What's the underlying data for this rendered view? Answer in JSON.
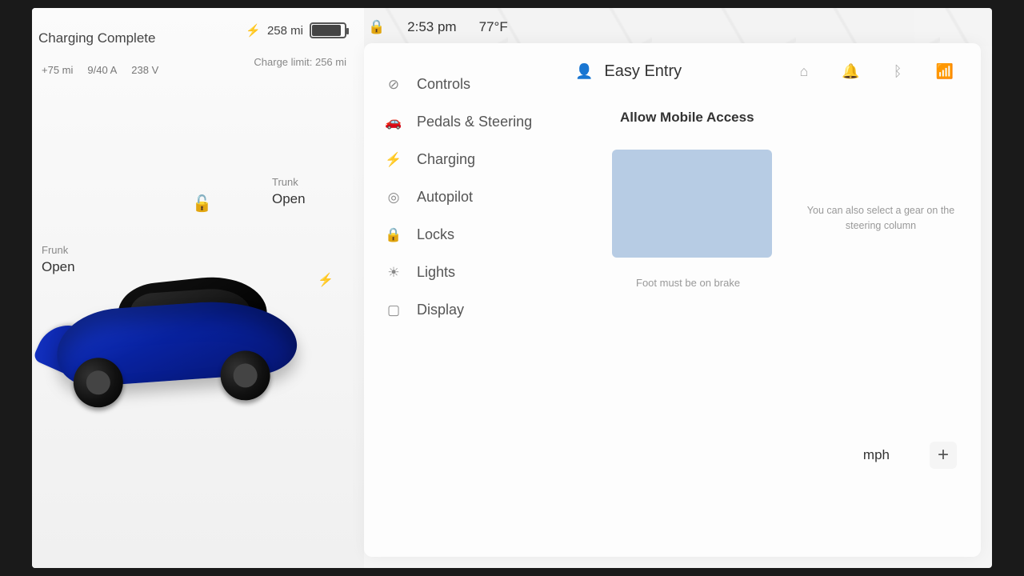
{
  "status_bar": {
    "lock_icon": "lock",
    "time": "2:53 pm",
    "temperature": "77°F"
  },
  "car_panel": {
    "status_title": "Charging Complete",
    "range_bolt": "⚡",
    "range": "258 mi",
    "added": "+75 mi",
    "amps": "9/40 A",
    "volts": "238 V",
    "charge_limit": "Charge limit: 256 mi",
    "frunk_label": "Frunk",
    "frunk_state": "Open",
    "trunk_label": "Trunk",
    "trunk_state": "Open"
  },
  "settings": {
    "nav": [
      {
        "icon": "⊘",
        "label": "Controls"
      },
      {
        "icon": "🚗",
        "label": "Pedals & Steering"
      },
      {
        "icon": "⚡",
        "label": "Charging"
      },
      {
        "icon": "◎",
        "label": "Autopilot"
      },
      {
        "icon": "🔒",
        "label": "Locks"
      },
      {
        "icon": "☀",
        "label": "Lights"
      },
      {
        "icon": "▢",
        "label": "Display"
      }
    ],
    "profile": {
      "name": "Easy Entry"
    },
    "content": {
      "mobile_access": "Allow Mobile Access",
      "gear_hint": "You can also select a gear on the steering column",
      "brake_hint": "Foot must be on brake",
      "speed_unit": "mph",
      "plus": "+"
    }
  }
}
